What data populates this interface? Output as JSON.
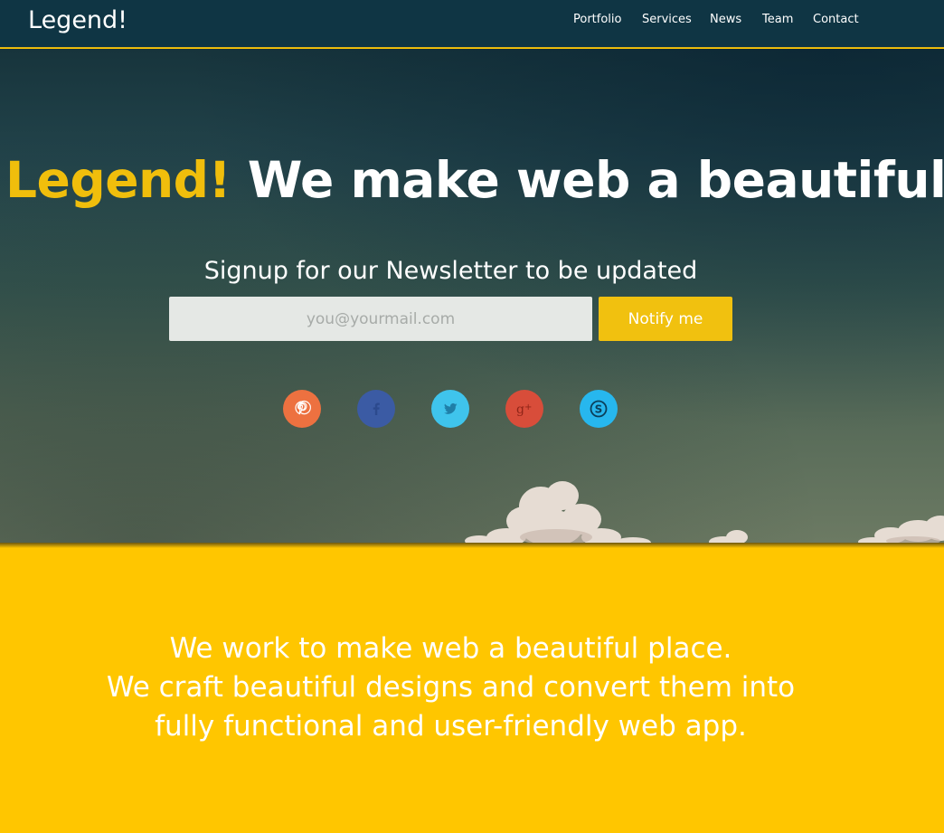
{
  "navbar": {
    "brand": "Legend!",
    "links": [
      "Portfolio",
      "Services",
      "News",
      "Team",
      "Contact"
    ]
  },
  "hero": {
    "title_accent": "Legend!",
    "title_rest": " We make web a beautiful place.",
    "signup_label": "Signup for our Newsletter to be updated",
    "email_placeholder": "you@yourmail.com",
    "notify_label": "Notify me",
    "social_icons": [
      "pinterest-icon",
      "facebook-icon",
      "twitter-icon",
      "google-plus-icon",
      "skype-icon"
    ]
  },
  "about": {
    "lines": [
      "We work to make web a beautiful place.",
      "We craft beautiful designs and convert them into",
      "fully functional and user-friendly web app."
    ]
  },
  "colors": {
    "navbar_bg": "#0f3544",
    "accent": "#f0be0c",
    "about_bg": "#ffc600",
    "pinterest": "#ed7140",
    "facebook": "#3b5ba4",
    "twitter": "#3fc4ec",
    "google_plus": "#d84d3a",
    "skype": "#27b7ee"
  }
}
